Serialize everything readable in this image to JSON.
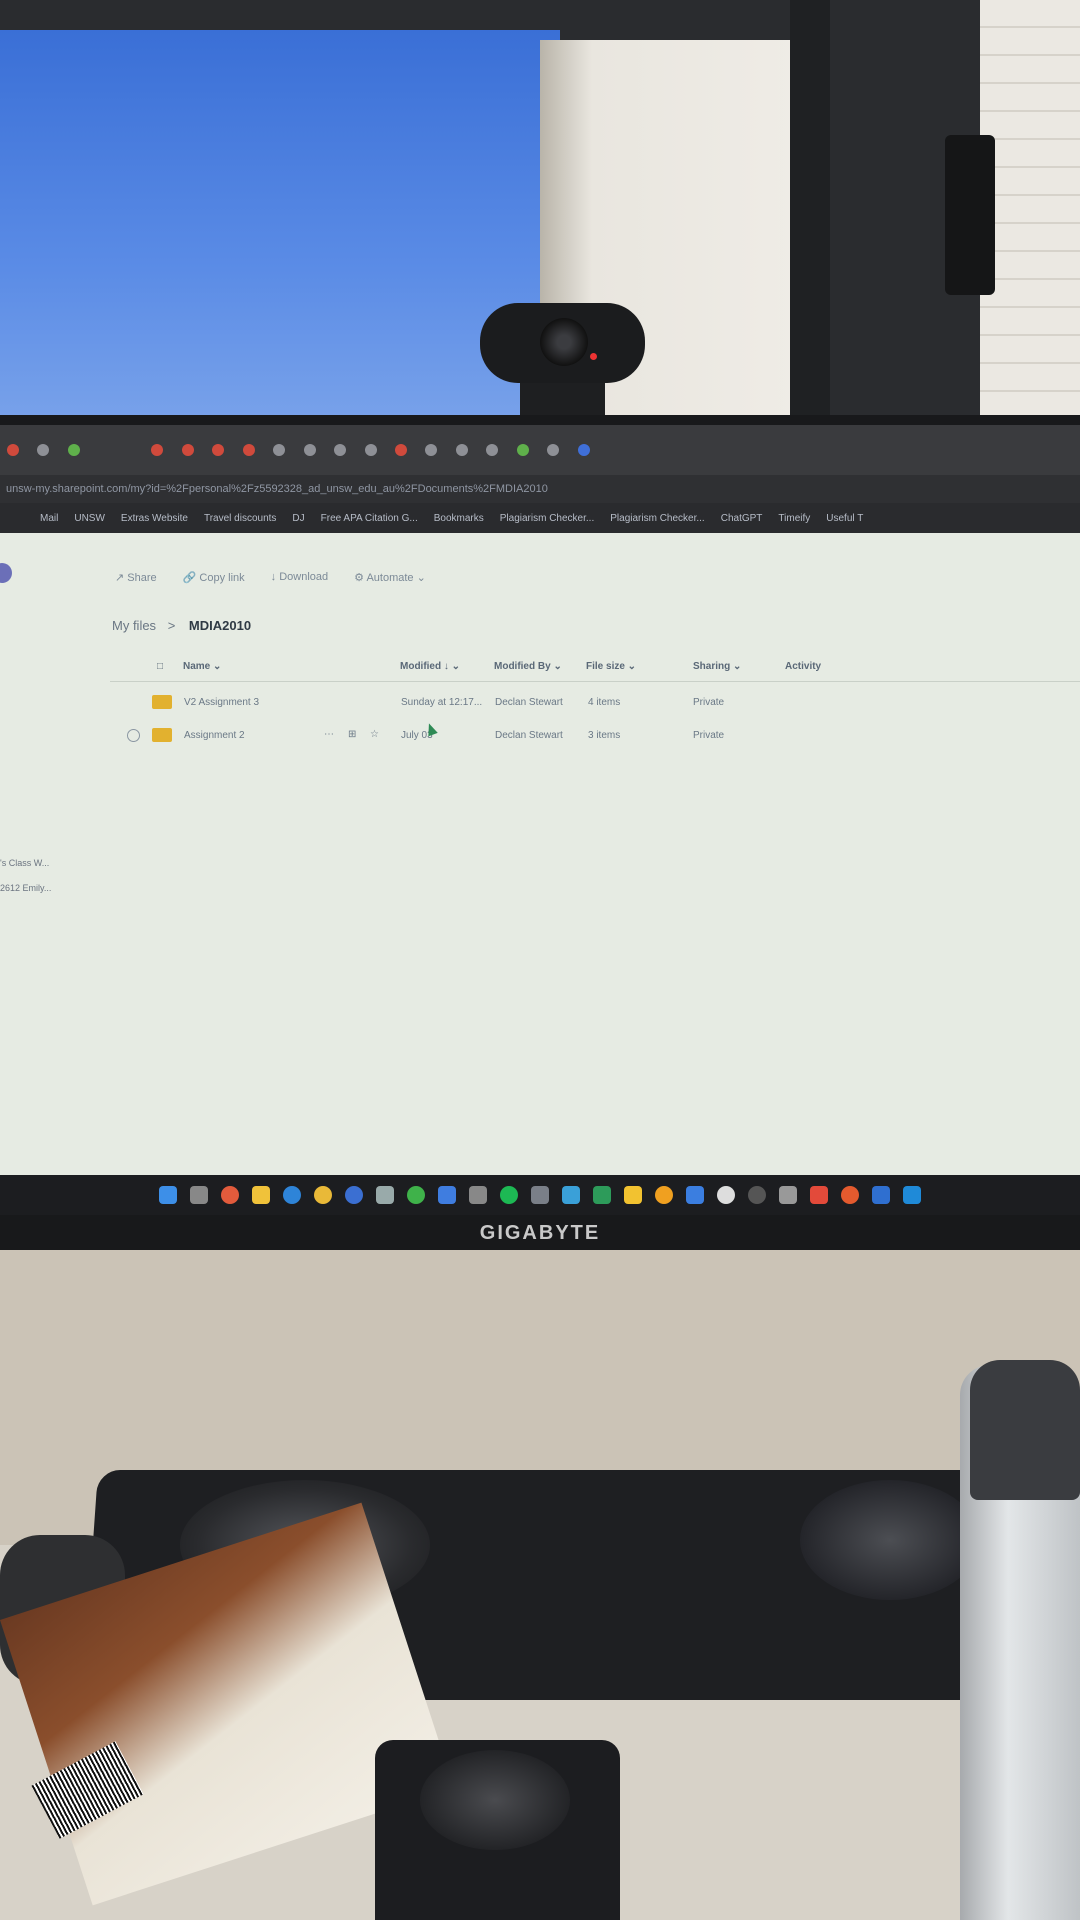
{
  "browser": {
    "address": "unsw-my.sharepoint.com/my?id=%2Fpersonal%2Fz5592328_ad_unsw_edu_au%2FDocuments%2FMDIA2010",
    "bookmarks": [
      "Mail",
      "UNSW",
      "Extras Website",
      "Travel discounts",
      "DJ",
      "Free APA Citation G...",
      "Bookmarks",
      "Plagiarism Checker...",
      "Plagiarism Checker...",
      "ChatGPT",
      "Timeify",
      "Useful T"
    ]
  },
  "commandbar": {
    "share": "Share",
    "copy_link": "Copy link",
    "download": "Download",
    "automate": "Automate"
  },
  "breadcrumb": {
    "root": "My files",
    "separator": ">",
    "current": "MDIA2010"
  },
  "table": {
    "headers": {
      "name": "Name",
      "modified": "Modified",
      "modified_by": "Modified By",
      "file_size": "File size",
      "sharing": "Sharing",
      "activity": "Activity"
    },
    "rows": [
      {
        "name": "V2 Assignment 3",
        "modified": "Sunday at 12:17...",
        "modified_by": "Declan Stewart",
        "size": "4 items",
        "sharing": "Private"
      },
      {
        "name": "Assignment 2",
        "modified": "July 03",
        "modified_by": "Declan Stewart",
        "size": "3 items",
        "sharing": "Private"
      }
    ]
  },
  "sidebar": {
    "items": [
      "'s Class W...",
      "2612 Emily..."
    ]
  },
  "monitor": {
    "brand": "GIGABYTE"
  }
}
